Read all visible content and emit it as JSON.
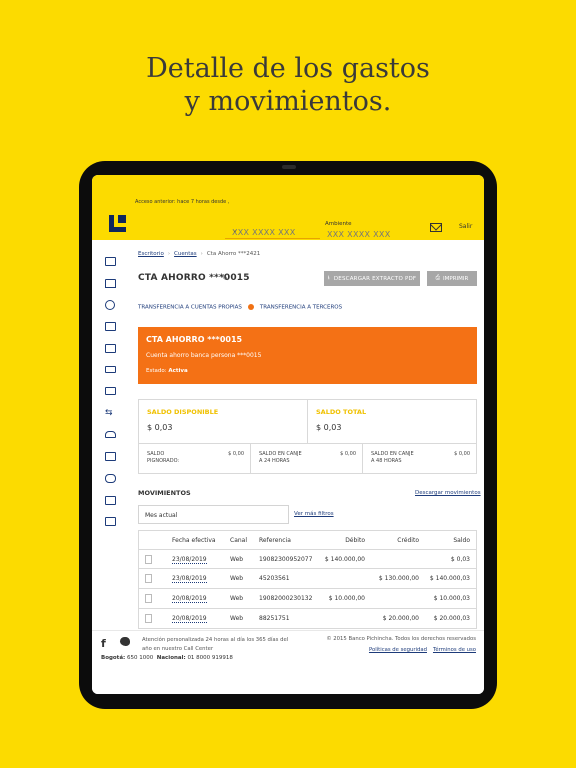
{
  "promo": {
    "line1": "Detalle de los gastos",
    "line2": "y movimientos."
  },
  "colors": {
    "brand_yellow": "#FCDB00",
    "brand_blue": "#0f265c",
    "accent_orange": "#f47115",
    "link_blue": "#1d3b7a",
    "button_grey": "#a7a7a7"
  },
  "header": {
    "last_access": "Acceso anterior: hace 7 horas desde ,",
    "user_placeholder": "XXX XXXX XXX",
    "ambiente_label": "Ambiente",
    "ambiente_value": "XXX XXXX XXX",
    "logout": "Salir",
    "icons": [
      "logo",
      "chevron-down-icon",
      "mail-icon"
    ]
  },
  "sidebar": {
    "icons": [
      "notebook-icon",
      "home-icon",
      "clock-icon",
      "briefcase-icon",
      "deposit-icon",
      "card-icon",
      "id-card-icon",
      "transfer-icon",
      "car-icon",
      "document-icon",
      "group-icon",
      "bank-icon",
      "map-icon"
    ]
  },
  "breadcrumb": {
    "item1": "Escritorio",
    "item2": "Cuentas",
    "item3": "Cta Ahorro ***2421"
  },
  "account": {
    "title": "CTA AHORRO ***0015",
    "download_pdf": "DESCARGAR EXTRACTO PDF",
    "print": "IMPRIMIR"
  },
  "tabs": {
    "tab1": "TRANSFERENCIA A CUENTAS PROPIAS",
    "tab2": "TRANSFERENCIA A TERCEROS"
  },
  "card": {
    "title": "CTA AHORRO  ***0015",
    "subtitle": "Cuenta ahorro banca persona ***0015",
    "estado_label": "Estado:",
    "estado_value": "Activa"
  },
  "saldos": {
    "disponible_label": "SALDO DISPONIBLE",
    "disponible_value": "$ 0,03",
    "total_label": "SALDO TOTAL",
    "total_value": "$ 0,03",
    "pignorado_label_1": "SALDO",
    "pignorado_label_2": "PIGNORADO:",
    "pignorado_value": "$ 0,00",
    "canje24_label_1": "SALDO EN CANJE",
    "canje24_label_2": "A 24 HORAS",
    "canje24_value": "$ 0,00",
    "canje48_label_1": "SALDO EN CANJE",
    "canje48_label_2": "A 48 HORAS",
    "canje48_value": "$ 0,00"
  },
  "movimientos": {
    "title": "MOVIMIENTOS",
    "download_link": "Descargar movimientos",
    "period": "Mes actual",
    "more_filters": "Ver más filtros",
    "columns": {
      "fecha": "Fecha efectiva",
      "canal": "Canal",
      "referencia": "Referencia",
      "debito": "Débito",
      "credito": "Crédito",
      "saldo": "Saldo"
    },
    "rows": [
      {
        "fecha": "23/08/2019",
        "canal": "Web",
        "referencia": "19082300952077",
        "debito": "$ 140.000,00",
        "credito": "",
        "saldo": "$ 0,03"
      },
      {
        "fecha": "23/08/2019",
        "canal": "Web",
        "referencia": "45203561",
        "debito": "",
        "credito": "$ 130.000,00",
        "saldo": "$ 140.000,03"
      },
      {
        "fecha": "20/08/2019",
        "canal": "Web",
        "referencia": "19082000230132",
        "debito": "$ 10.000,00",
        "credito": "",
        "saldo": "$ 10.000,03"
      },
      {
        "fecha": "20/08/2019",
        "canal": "Web",
        "referencia": "88251751",
        "debito": "",
        "credito": "$ 20.000,00",
        "saldo": "$ 20.000,03"
      }
    ]
  },
  "footer": {
    "attention": "Atención personalizada 24 horas al día los 365 días del año en nuestro Call Center",
    "bogota_label": "Bogotá:",
    "bogota_phone": "650 1000",
    "national_label": "Nacional:",
    "national_phone": "01 8000 919918",
    "copyright": "© 2015 Banco Pichincha. Todos los derechos reservados",
    "link_security": "Políticas de seguridad",
    "link_terms": "Términos de uso"
  }
}
